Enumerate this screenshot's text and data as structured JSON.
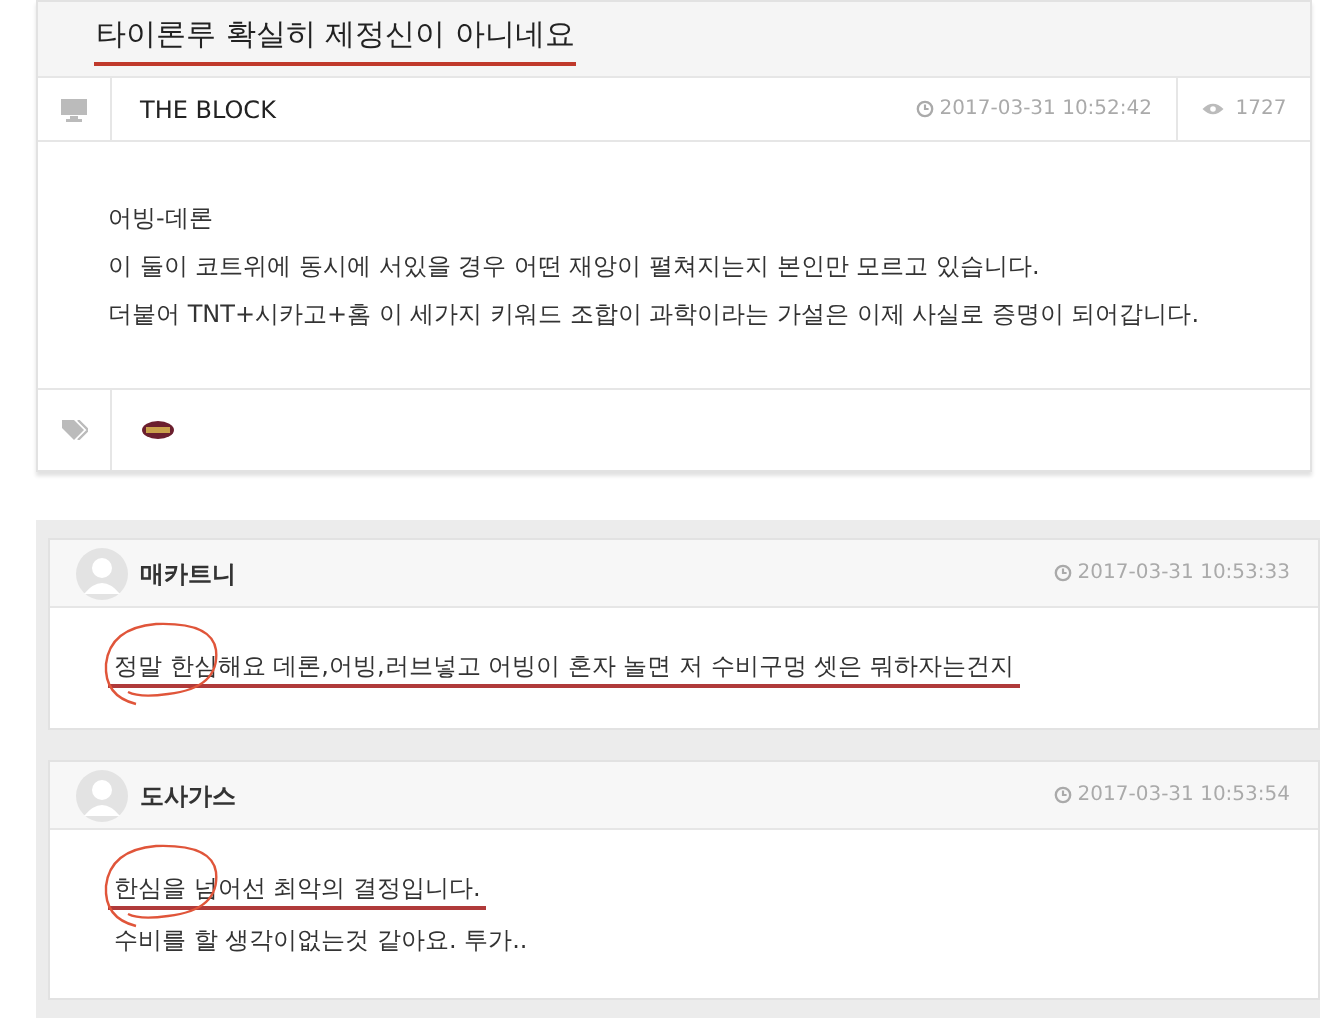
{
  "post": {
    "title": "타이론루 확실히 제정신이 아니네요",
    "title_underlined": true,
    "author": "THE BLOCK",
    "date": "2017-03-31 10:52:42",
    "views": "1727",
    "body": [
      "어빙-데론",
      "이 둘이 코트위에 동시에 서있을 경우 어떤 재앙이 펼쳐지는지 본인만 모르고 있습니다.",
      "더붙어 TNT+시카고+홈 이 세가지 키워드 조합이 과학이라는 가설은 이제 사실로 증명이 되어갑니다."
    ]
  },
  "comments": [
    {
      "author": "매카트니",
      "date": "2017-03-31 10:53:33",
      "lines": [
        {
          "text": "정말 한심해요  데론,어빙,러브넣고 어빙이 혼자 놀면 저 수비구멍 셋은 뭐하자는건지",
          "underlined": true,
          "circled": true
        }
      ]
    },
    {
      "author": "도사가스",
      "date": "2017-03-31 10:53:54",
      "lines": [
        {
          "text": "한심을 넘어선 최악의 결정입니다.",
          "underlined": true,
          "circled": true
        },
        {
          "text": "수비를 할 생각이없는것 같아요. 투가..",
          "underlined": false,
          "circled": false
        }
      ]
    }
  ]
}
